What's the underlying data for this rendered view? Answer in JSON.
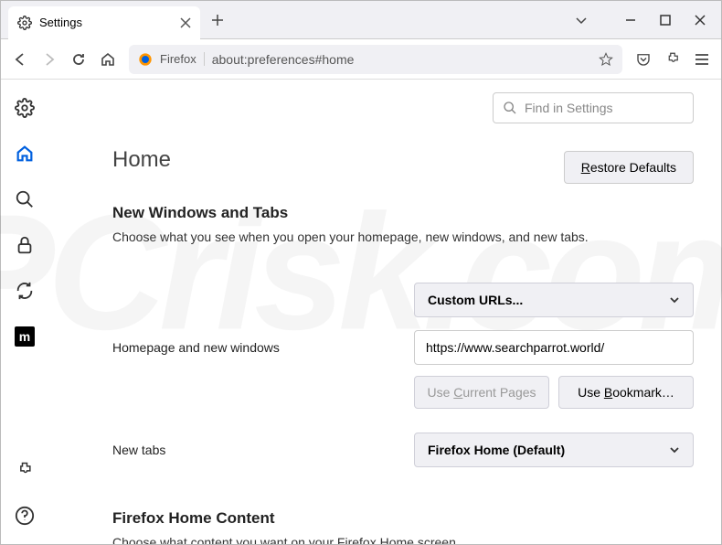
{
  "tab": {
    "title": "Settings"
  },
  "urlbar": {
    "prefix": "Firefox",
    "url": "about:preferences#home"
  },
  "search": {
    "placeholder": "Find in Settings"
  },
  "page": {
    "title": "Home",
    "restore": "Restore Defaults",
    "restore_underline": "R",
    "restore_rest": "estore Defaults"
  },
  "section1": {
    "title": "New Windows and Tabs",
    "desc": "Choose what you see when you open your homepage, new windows, and new tabs."
  },
  "homepage": {
    "label": "Homepage and new windows",
    "dropdown": "Custom URLs...",
    "url": "https://www.searchparrot.world/",
    "use_current": "Use Current Pages",
    "use_current_ul": "C",
    "use_bookmark": "Use Bookmark…",
    "use_bookmark_ul": "B"
  },
  "newtabs": {
    "label": "New tabs",
    "dropdown": "Firefox Home (Default)"
  },
  "section2": {
    "title": "Firefox Home Content",
    "desc": "Choose what content you want on your Firefox Home screen."
  },
  "watermark": "PCrisk.com"
}
